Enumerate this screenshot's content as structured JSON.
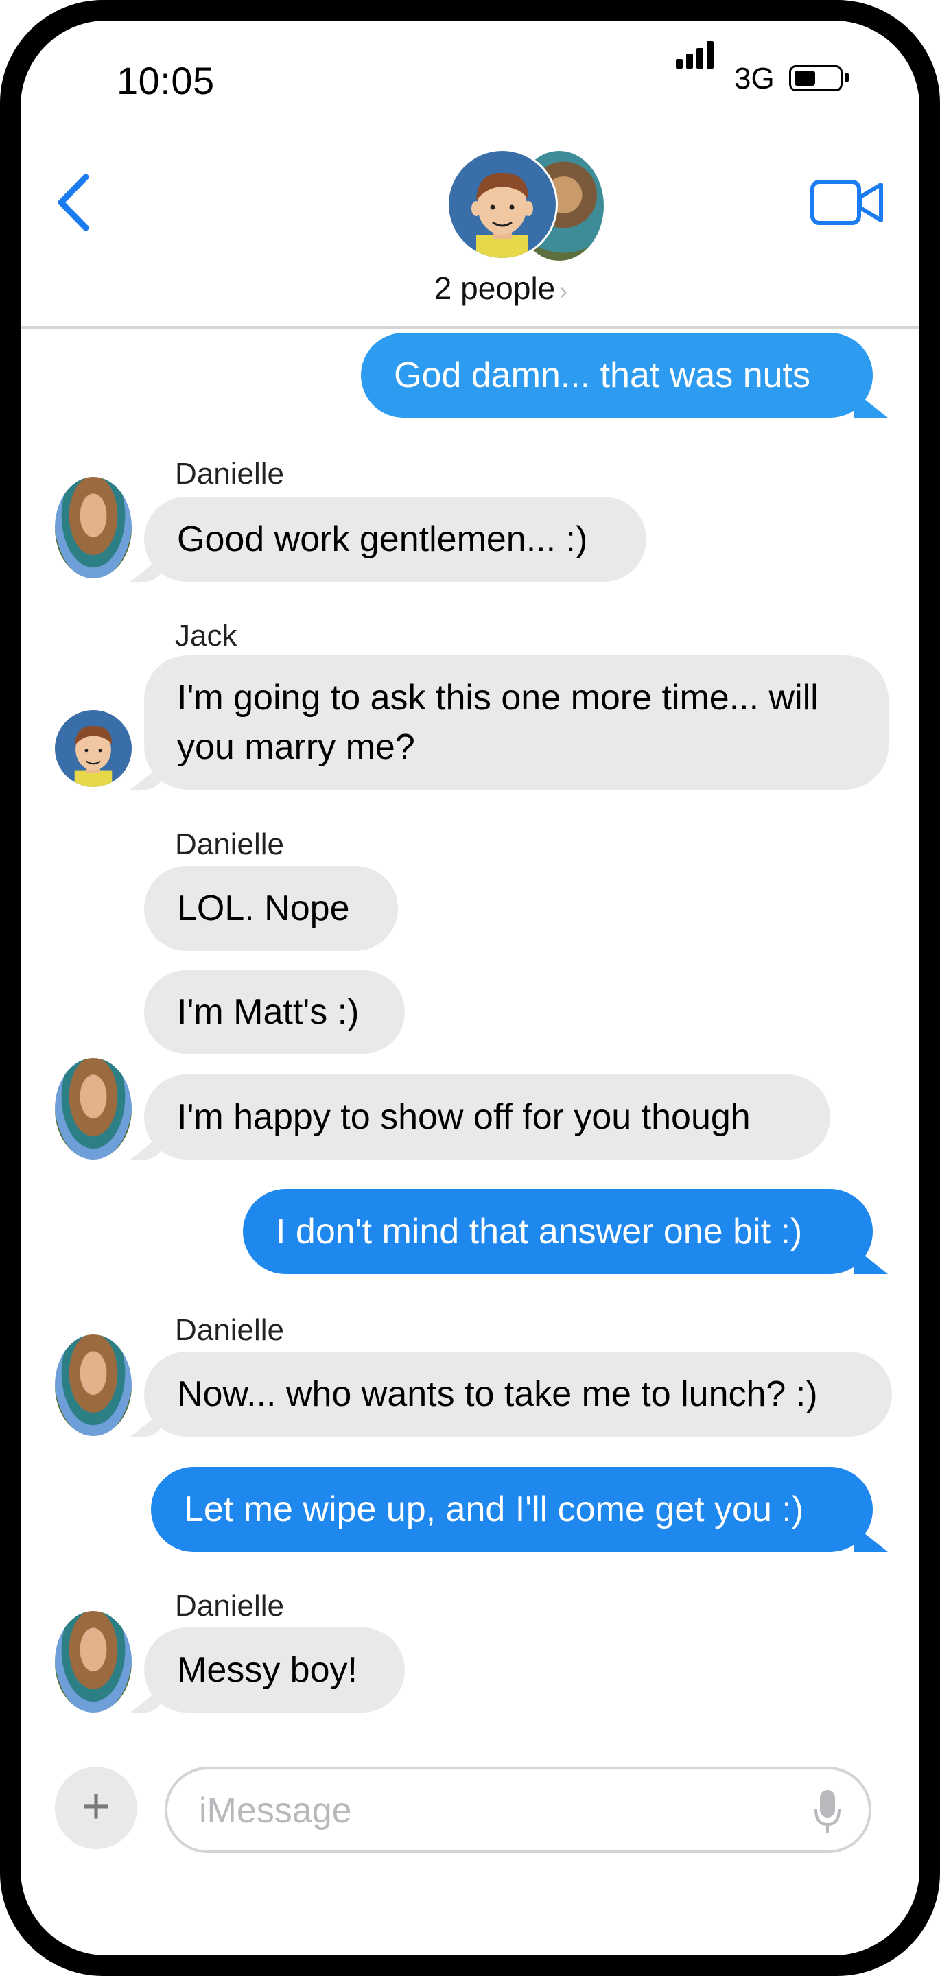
{
  "status_bar": {
    "time": "10:05",
    "network": "3G",
    "signal_bars": 4
  },
  "header": {
    "participants_label": "2 people"
  },
  "messages": [
    {
      "dir": "out",
      "text": "God damn... that was nuts"
    },
    {
      "dir": "in",
      "sender": "Danielle",
      "text": "Good work gentlemen... :)"
    },
    {
      "dir": "in",
      "sender": "Jack",
      "lines": [
        "I'm going to ask this one more time... will",
        "you marry me?"
      ]
    },
    {
      "dir": "in",
      "sender": "Danielle",
      "text": "LOL.  Nope"
    },
    {
      "dir": "in",
      "text": "I'm Matt's :)"
    },
    {
      "dir": "in",
      "text": "I'm happy to show off for you though"
    },
    {
      "dir": "out",
      "text": "I don't mind that answer one bit :)"
    },
    {
      "dir": "in",
      "sender": "Danielle",
      "text": "Now... who wants to take me to lunch? :)"
    },
    {
      "dir": "out",
      "text": "Let me wipe up, and I'll come get you :)"
    },
    {
      "dir": "in",
      "sender": "Danielle",
      "text": "Messy boy!"
    }
  ],
  "composer": {
    "placeholder": "iMessage",
    "value": ""
  },
  "colors": {
    "accent": "#1a7cf0",
    "outgoing_bubble": "#2d9bf0",
    "incoming_bubble": "#e9e9eb"
  }
}
